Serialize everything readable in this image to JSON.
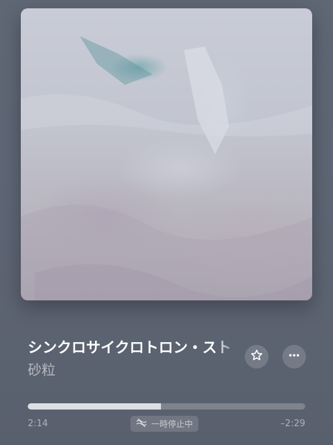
{
  "now_playing": {
    "title": "シンクロサイクロトロン・スト",
    "artist": "砂粒"
  },
  "artwork": {
    "icon": "album-artwork"
  },
  "actions": {
    "favorite_icon": "star-icon",
    "more_icon": "ellipsis-icon"
  },
  "playback": {
    "elapsed": "2:14",
    "remaining": "–2:29",
    "progress": 0.48,
    "status_label": "一時停止中",
    "status_icon": "lossless-off-icon"
  },
  "colors": {
    "background": "#5e6574",
    "progress_fill": "#ebecf0",
    "progress_track": "#7e848f"
  }
}
